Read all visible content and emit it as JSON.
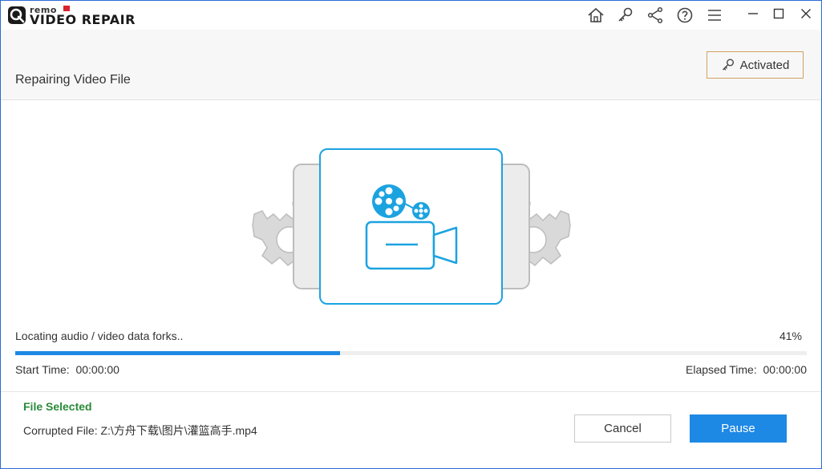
{
  "app": {
    "brand": "remo",
    "product": "VIDEO REPAIR"
  },
  "toolbar": {
    "icons": [
      "home-icon",
      "key-icon",
      "share-icon",
      "help-icon",
      "menu-icon"
    ],
    "window_controls": [
      "minimize-icon",
      "maximize-icon",
      "close-icon"
    ]
  },
  "header": {
    "title": "Repairing Video File",
    "activated_label": "Activated"
  },
  "progress": {
    "status": "Locating audio / video data forks..",
    "percent_label": "41%",
    "percent_value": 41,
    "start_time_label": "Start Time:",
    "start_time_value": "00:00:00",
    "elapsed_time_label": "Elapsed Time:",
    "elapsed_time_value": "00:00:00"
  },
  "footer": {
    "file_selected_label": "File Selected",
    "corrupted_label": "Corrupted File:",
    "corrupted_path": "Z:\\方舟下载\\图片\\灌篮高手.mp4",
    "cancel_label": "Cancel",
    "pause_label": "Pause"
  },
  "colors": {
    "accent": "#1e88e5",
    "illustration_blue": "#1ba3e0",
    "gear_gray": "#d6d6d6",
    "success_green": "#2a8a3a",
    "activated_border": "#d2a062"
  }
}
